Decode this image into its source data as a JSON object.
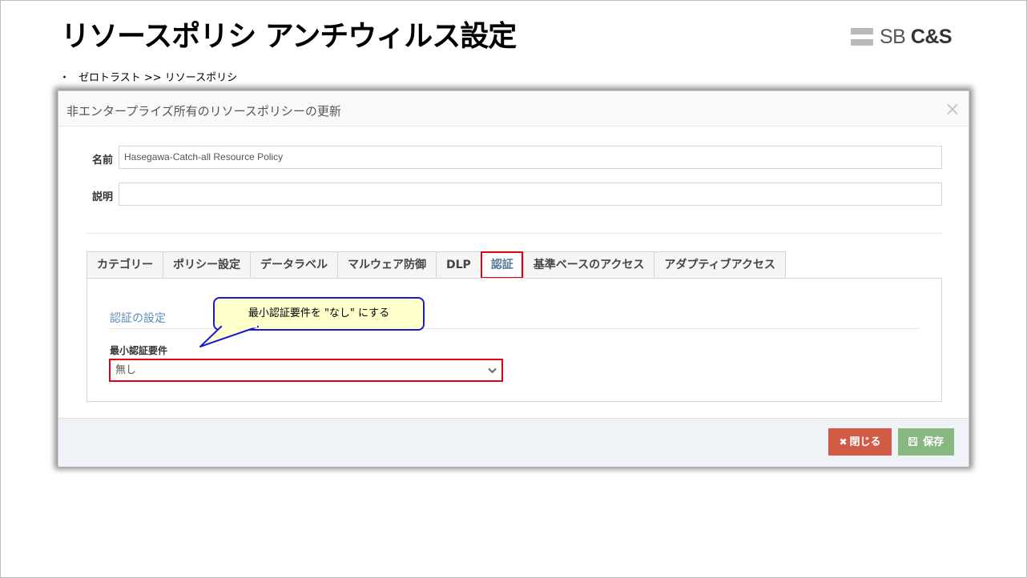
{
  "slide": {
    "title": "リソースポリシ アンチウィルス設定",
    "breadcrumb_bullet": "・",
    "breadcrumb": "ゼロトラスト >> リソースポリシ"
  },
  "logo": {
    "sb": "SB",
    "cs": "C&S"
  },
  "modal": {
    "title": "非エンタープライズ所有のリソースポリシーの更新",
    "close_glyph": "×",
    "name_label": "名前",
    "name_value": "Hasegawa-Catch-all Resource Policy",
    "description_label": "説明",
    "description_value": "",
    "tabs": [
      {
        "label": "カテゴリー"
      },
      {
        "label": "ポリシー設定"
      },
      {
        "label": "データラベル"
      },
      {
        "label": "マルウェア防御"
      },
      {
        "label": "DLP"
      },
      {
        "label": "認証"
      },
      {
        "label": "基準ベースのアクセス"
      },
      {
        "label": "アダプティブアクセス"
      }
    ],
    "active_tab": "認証",
    "section_title": "認証の設定",
    "min_auth_label": "最小認証要件",
    "min_auth_value": "無し",
    "buttons": {
      "close": "閉じる",
      "save": "保存"
    }
  },
  "callout": {
    "text": "最小認証要件を \"なし\" にする"
  },
  "colors": {
    "highlight": "#e00012",
    "callout_border": "#1a1ad6",
    "callout_fill": "#ffffcc",
    "close_button": "#d15b47",
    "save_button": "#87b87f"
  },
  "icons": {
    "close": "close-icon",
    "chevron": "chevron-down-icon",
    "save": "floppy-icon",
    "times": "times-icon"
  }
}
